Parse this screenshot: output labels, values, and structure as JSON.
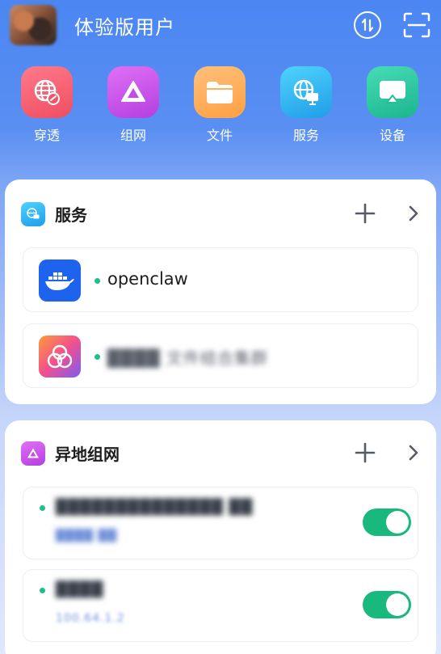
{
  "header": {
    "user_name": "体验版用户",
    "sync_icon": "sync-icon",
    "scan_icon": "scan-icon"
  },
  "quick_actions": [
    {
      "label": "穿透",
      "icon": "globe-link-icon",
      "color": "#f25c6e"
    },
    {
      "label": "组网",
      "icon": "network-triangle-icon",
      "color": "#c14be6"
    },
    {
      "label": "文件",
      "icon": "folder-icon",
      "color": "#ffa94d"
    },
    {
      "label": "服务",
      "icon": "globe-monitor-icon",
      "color": "#2bb6f0"
    },
    {
      "label": "设备",
      "icon": "device-cast-icon",
      "color": "#25c4a0"
    }
  ],
  "services_card": {
    "title": "服务",
    "items": [
      {
        "name": "openclaw",
        "icon": "docker-icon",
        "status": "online"
      },
      {
        "name": "████ 文件结合集群",
        "icon": "photos-app-icon",
        "status": "online"
      }
    ]
  },
  "network_card": {
    "title": "异地组网",
    "items": [
      {
        "name": "██████████████ ██",
        "address": "████ ██",
        "enabled": true
      },
      {
        "name": "████",
        "address": "100.64.1.2",
        "enabled": true
      }
    ]
  },
  "colors": {
    "accent": "#4b86f3",
    "status_online": "#1fbf8a",
    "toggle_on": "#19b87d"
  }
}
